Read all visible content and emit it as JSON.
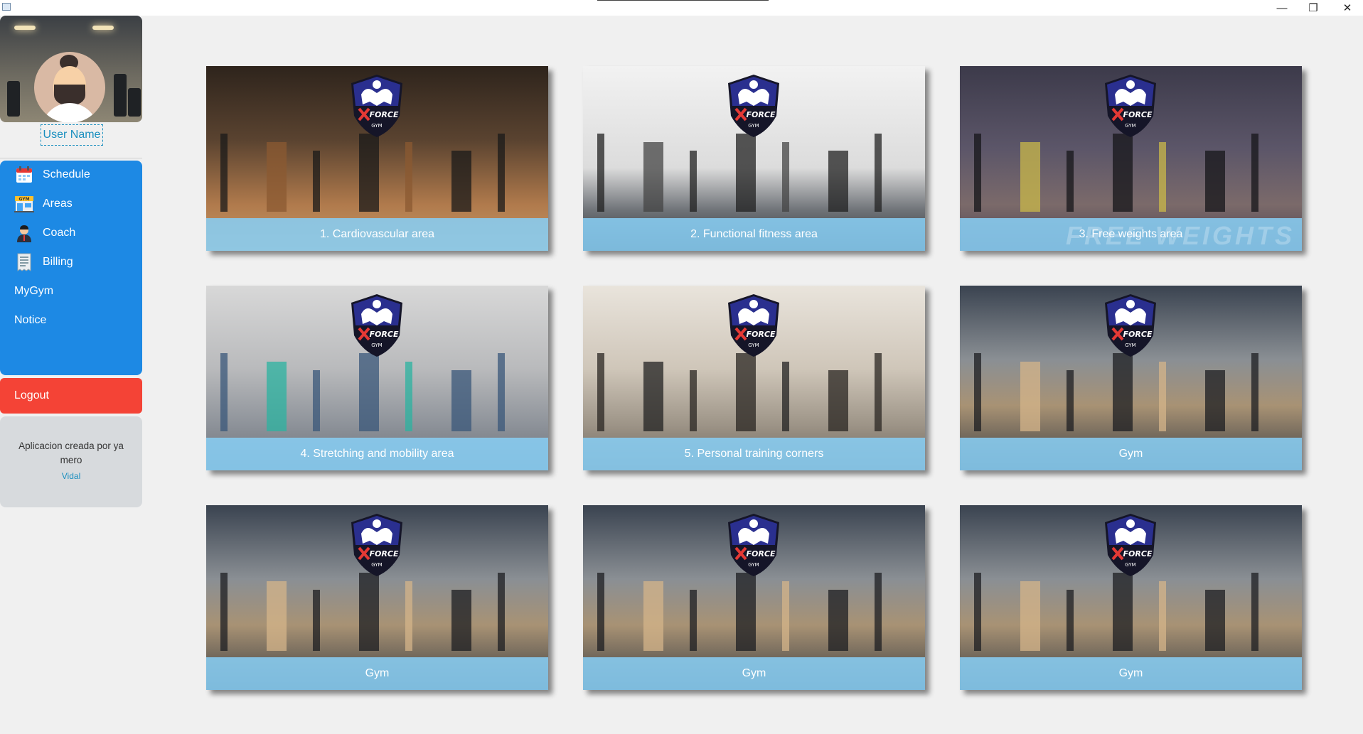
{
  "window": {
    "minimize_glyph": "—",
    "maximize_glyph": "❐",
    "close_glyph": "✕"
  },
  "sidebar": {
    "username": "User Name",
    "menu": [
      {
        "label": "Schedule",
        "icon": "calendar-icon"
      },
      {
        "label": "Areas",
        "icon": "gym-building-icon"
      },
      {
        "label": "Coach",
        "icon": "coach-icon"
      },
      {
        "label": "Billing",
        "icon": "receipt-icon"
      },
      {
        "label": "MyGym",
        "icon": ""
      },
      {
        "label": "Notice",
        "icon": ""
      }
    ],
    "logout": "Logout",
    "credits": {
      "line": "Aplicacion creada por ya mero",
      "author": "Vidal"
    },
    "colors": {
      "menu": "#1d89e4",
      "logout": "#f44336",
      "credits_bg": "#d7dadd"
    }
  },
  "badge": {
    "brand": "FORCE",
    "sub": "GYM",
    "colors": {
      "shield": "#2a2f8f",
      "dark": "#151528",
      "cross": "#e53935"
    }
  },
  "cards": [
    {
      "caption": "1. Cardiovascular area",
      "theme": "cardio"
    },
    {
      "caption": "2. Functional fitness area",
      "theme": "functional"
    },
    {
      "caption": "3. Free weights area",
      "theme": "weights",
      "watermark": "FREE WEIGHTS"
    },
    {
      "caption": "4. Stretching and mobility area",
      "theme": "stretch"
    },
    {
      "caption": "5. Personal training corners",
      "theme": "personal"
    },
    {
      "caption": "Gym",
      "theme": "gym"
    },
    {
      "caption": "Gym",
      "theme": "gym"
    },
    {
      "caption": "Gym",
      "theme": "gym"
    },
    {
      "caption": "Gym",
      "theme": "gym"
    }
  ]
}
